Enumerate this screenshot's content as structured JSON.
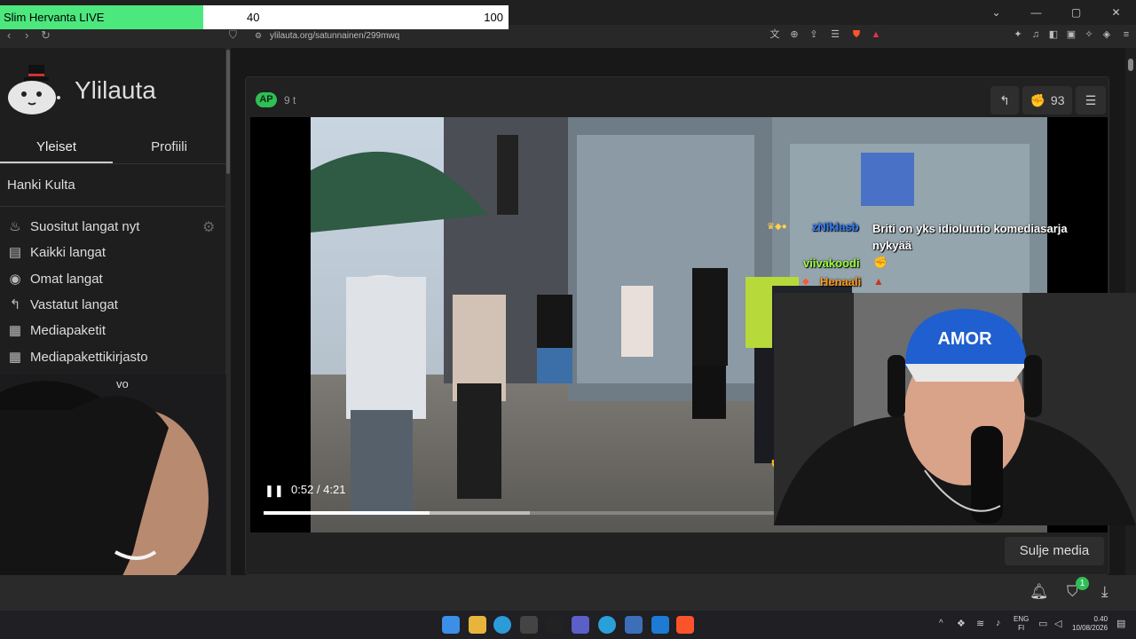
{
  "stream_goal": {
    "title": "Slim Hervanta LIVE",
    "current": "40",
    "goal": "100",
    "progress": 0.4
  },
  "browser": {
    "url": "ylilauta.org/satunnainen/299mwq"
  },
  "sidebar": {
    "site_name": "Ylilauta",
    "tabs": [
      "Yleiset",
      "Profiili"
    ],
    "gold_link": "Hanki Kulta",
    "items": [
      {
        "label": "Suositut langat nyt",
        "icon": "fire-icon"
      },
      {
        "label": "Kaikki langat",
        "icon": "list-icon"
      },
      {
        "label": "Omat langat",
        "icon": "user-threads-icon"
      },
      {
        "label": "Vastatut langat",
        "icon": "reply-icon"
      },
      {
        "label": "Mediapaketit",
        "icon": "media-pack-icon"
      },
      {
        "label": "Mediapakettikirjasto",
        "icon": "library-icon"
      }
    ],
    "partial_text": "vo"
  },
  "post": {
    "badge": "AP",
    "age": "9 t",
    "likes": "93",
    "video": {
      "time": "0:52 / 4:21",
      "progress": 0.2
    },
    "close_media": "Sulje media"
  },
  "chat": [
    {
      "user": "zNiklasb",
      "message": "Briti on yks idioluutio komediasarja nykyää",
      "color": "#2f7dff"
    },
    {
      "user": "viivakoodi",
      "message": "",
      "color": "#9cff3a"
    },
    {
      "user": "Henaali",
      "message": "",
      "color": "#ff9a1a"
    }
  ],
  "bottombar": {
    "notification_count": "1"
  },
  "taskbar": {
    "lang_top": "ENG",
    "lang_bottom": "FI",
    "time": "0.40",
    "date": "10/08/2026"
  }
}
